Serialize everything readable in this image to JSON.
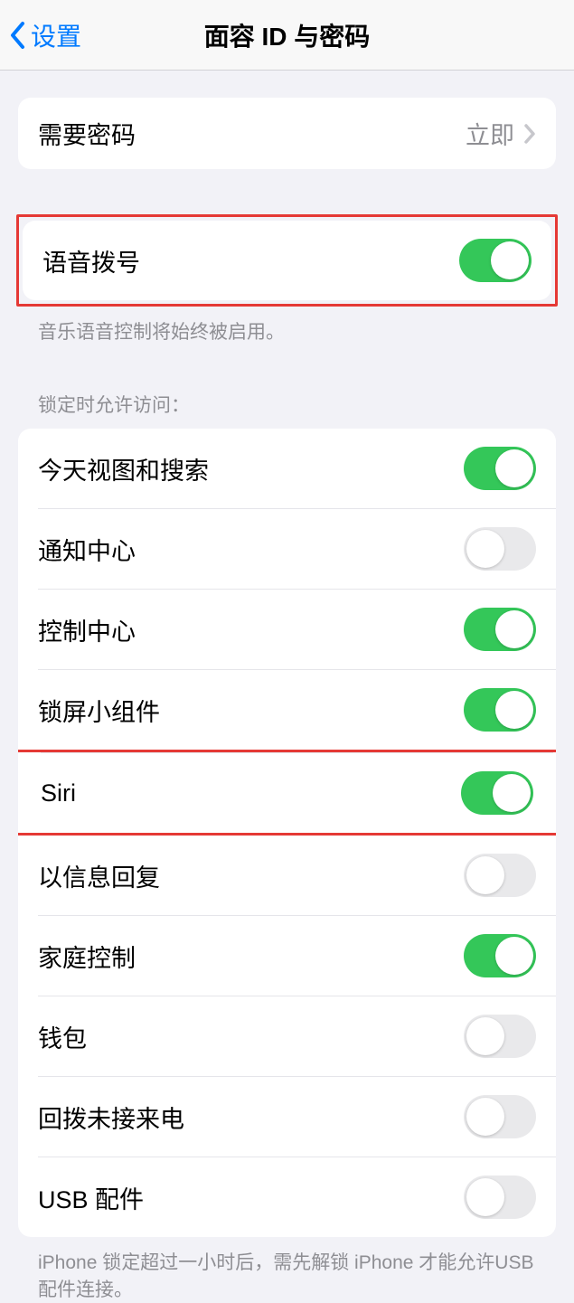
{
  "nav": {
    "back_label": "设置",
    "title": "面容 ID 与密码"
  },
  "require_passcode": {
    "label": "需要密码",
    "value": "立即"
  },
  "voice_dial": {
    "label": "语音拨号",
    "footer": "音乐语音控制将始终被启用。"
  },
  "lock_access": {
    "header": "锁定时允许访问：",
    "items": [
      {
        "label": "今天视图和搜索",
        "on": true,
        "highlight": false
      },
      {
        "label": "通知中心",
        "on": false,
        "highlight": false
      },
      {
        "label": "控制中心",
        "on": true,
        "highlight": false
      },
      {
        "label": "锁屏小组件",
        "on": true,
        "highlight": false
      },
      {
        "label": "Siri",
        "on": true,
        "highlight": true
      },
      {
        "label": "以信息回复",
        "on": false,
        "highlight": false
      },
      {
        "label": "家庭控制",
        "on": true,
        "highlight": false
      },
      {
        "label": "钱包",
        "on": false,
        "highlight": false
      },
      {
        "label": "回拨未接来电",
        "on": false,
        "highlight": false
      },
      {
        "label": "USB 配件",
        "on": false,
        "highlight": false
      }
    ],
    "footer": "iPhone 锁定超过一小时后，需先解锁 iPhone 才能允许USB 配件连接。"
  }
}
